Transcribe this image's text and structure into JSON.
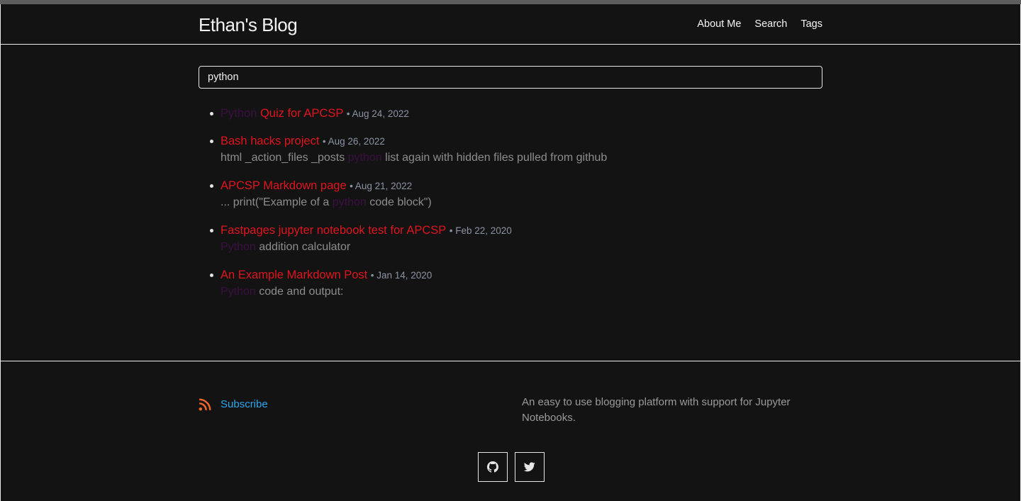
{
  "header": {
    "site_title": "Ethan's Blog",
    "nav": [
      {
        "label": "About Me"
      },
      {
        "label": "Search"
      },
      {
        "label": "Tags"
      }
    ]
  },
  "search": {
    "value": "python",
    "highlight_color": "#3c0f43"
  },
  "results": [
    {
      "title_hl": "Python",
      "title_rest": " Quiz for APCSP",
      "date": "• Aug 24, 2022",
      "excerpt_pre": "",
      "excerpt_hl": "",
      "excerpt_post": ""
    },
    {
      "title_hl": "",
      "title_rest": "Bash hacks project",
      "date": "• Aug 26, 2022",
      "excerpt_pre": "html _action_files _posts ",
      "excerpt_hl": "python",
      "excerpt_post": " list again with hidden files pulled from github"
    },
    {
      "title_hl": "",
      "title_rest": "APCSP Markdown page",
      "date": "• Aug 21, 2022",
      "excerpt_pre": "... print(\"Example of a ",
      "excerpt_hl": "python",
      "excerpt_post": " code block\")"
    },
    {
      "title_hl": "",
      "title_rest": "Fastpages jupyter notebook test for APCSP",
      "date": "• Feb 22, 2020",
      "excerpt_pre": "",
      "excerpt_hl": "Python",
      "excerpt_post": " addition calculator"
    },
    {
      "title_hl": "",
      "title_rest": "An Example Markdown Post",
      "date": "• Jan 14, 2020",
      "excerpt_pre": "",
      "excerpt_hl": "Python",
      "excerpt_post": " code and output:"
    }
  ],
  "footer": {
    "subscribe_label": "Subscribe",
    "subscribe_icon": "rss-icon",
    "description": "An easy to use blogging platform with support for Jupyter Notebooks.",
    "social": [
      {
        "icon": "github-icon"
      },
      {
        "icon": "twitter-icon"
      }
    ]
  },
  "colors": {
    "background": "#131313",
    "link_red": "#e0141e",
    "subscribe_blue": "#2aa7ee",
    "rss_orange": "#f26522"
  }
}
